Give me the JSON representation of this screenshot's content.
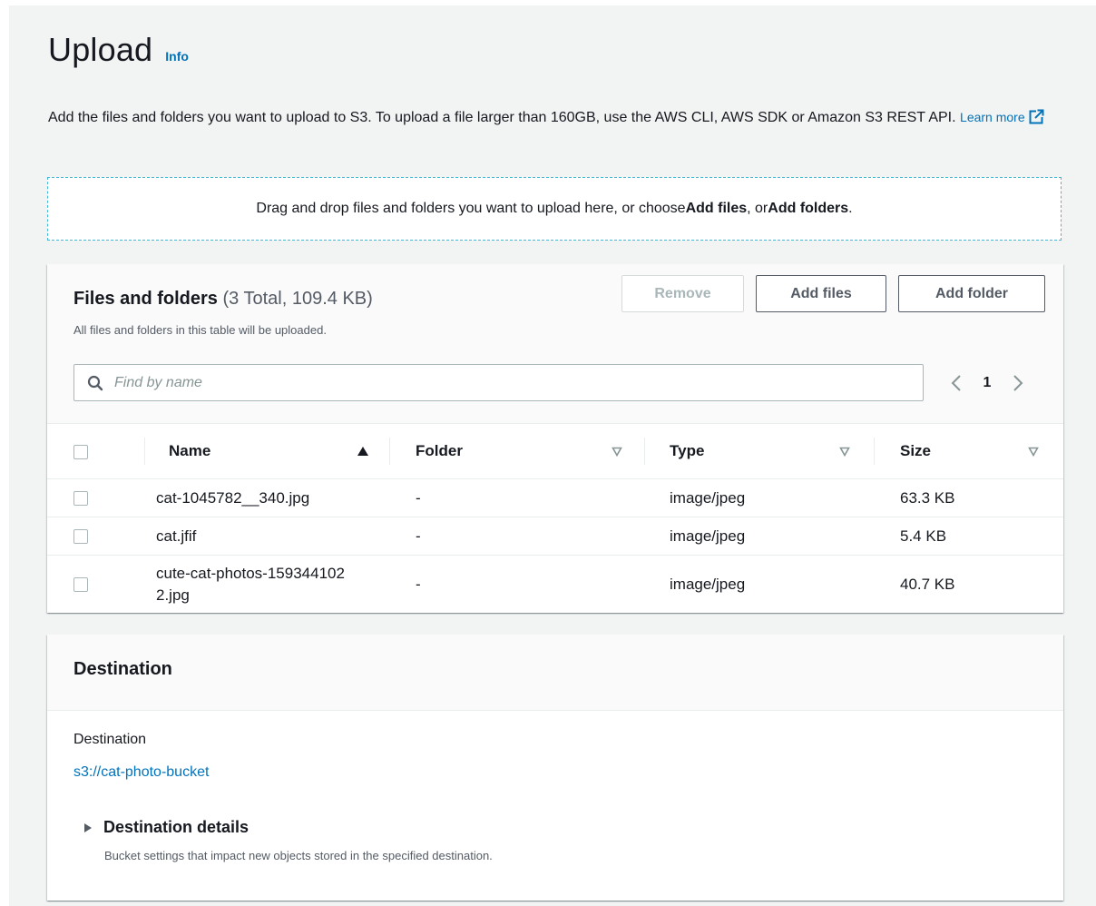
{
  "header": {
    "title": "Upload",
    "info_label": "Info",
    "description": "Add the files and folders you want to upload to S3. To upload a file larger than 160GB, use the AWS CLI, AWS SDK or Amazon S3 REST API.",
    "learn_more": "Learn more",
    "learn_more_icon": "external-link-icon"
  },
  "dropzone": {
    "text_before": "Drag and drop files and folders you want to upload here, or choose ",
    "add_files": "Add files",
    "text_middle": ", or ",
    "add_folders": "Add folders",
    "text_after": "."
  },
  "files": {
    "title": "Files and folders",
    "count": "(3 Total, 109.4 KB)",
    "subtitle": "All files and folders in this table will be uploaded.",
    "buttons": {
      "remove": "Remove",
      "add_files": "Add files",
      "add_folder": "Add folder"
    },
    "search_placeholder": "Find by name",
    "page": "1",
    "columns": {
      "name": "Name",
      "folder": "Folder",
      "type": "Type",
      "size": "Size"
    },
    "rows": [
      {
        "name": "cat-1045782__340.jpg",
        "folder": "-",
        "type": "image/jpeg",
        "size": "63.3 KB"
      },
      {
        "name": "cat.jfif",
        "folder": "-",
        "type": "image/jpeg",
        "size": "5.4 KB"
      },
      {
        "name": "cute-cat-photos-1593441022.jpg",
        "folder": "-",
        "type": "image/jpeg",
        "size": "40.7 KB"
      }
    ]
  },
  "destination": {
    "title": "Destination",
    "label": "Destination",
    "value": "s3://cat-photo-bucket",
    "details_title": "Destination details",
    "details_desc": "Bucket settings that impact new objects stored in the specified destination."
  },
  "colors": {
    "link": "#0073bb",
    "dropzone_border": "#44b9d6",
    "background": "#f2f3f3"
  }
}
